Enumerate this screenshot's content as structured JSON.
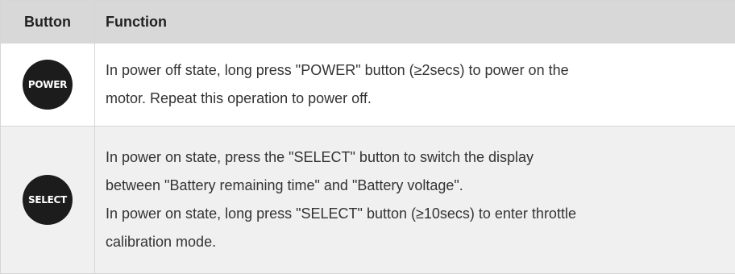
{
  "table": {
    "headers": {
      "button": "Button",
      "function": "Function"
    },
    "rows": [
      {
        "button_label": "POWER",
        "lines": [
          "In power off state, long press \"POWER\" button (≥2secs) to power on the",
          "motor. Repeat this operation to power off."
        ]
      },
      {
        "button_label": "SELECT",
        "lines": [
          "In power on state, press the \"SELECT\" button to switch the display",
          "between \"Battery remaining time\" and \"Battery voltage\".",
          "In power on state, long press \"SELECT\" button (≥10secs) to  enter throttle",
          "calibration mode."
        ]
      }
    ]
  },
  "colors": {
    "header_bg": "#d8d8d8",
    "alt_row_bg": "#f0f0f0",
    "button_bg": "#1c1c1c",
    "button_text": "#ffffff",
    "border": "#d6d6d6"
  }
}
